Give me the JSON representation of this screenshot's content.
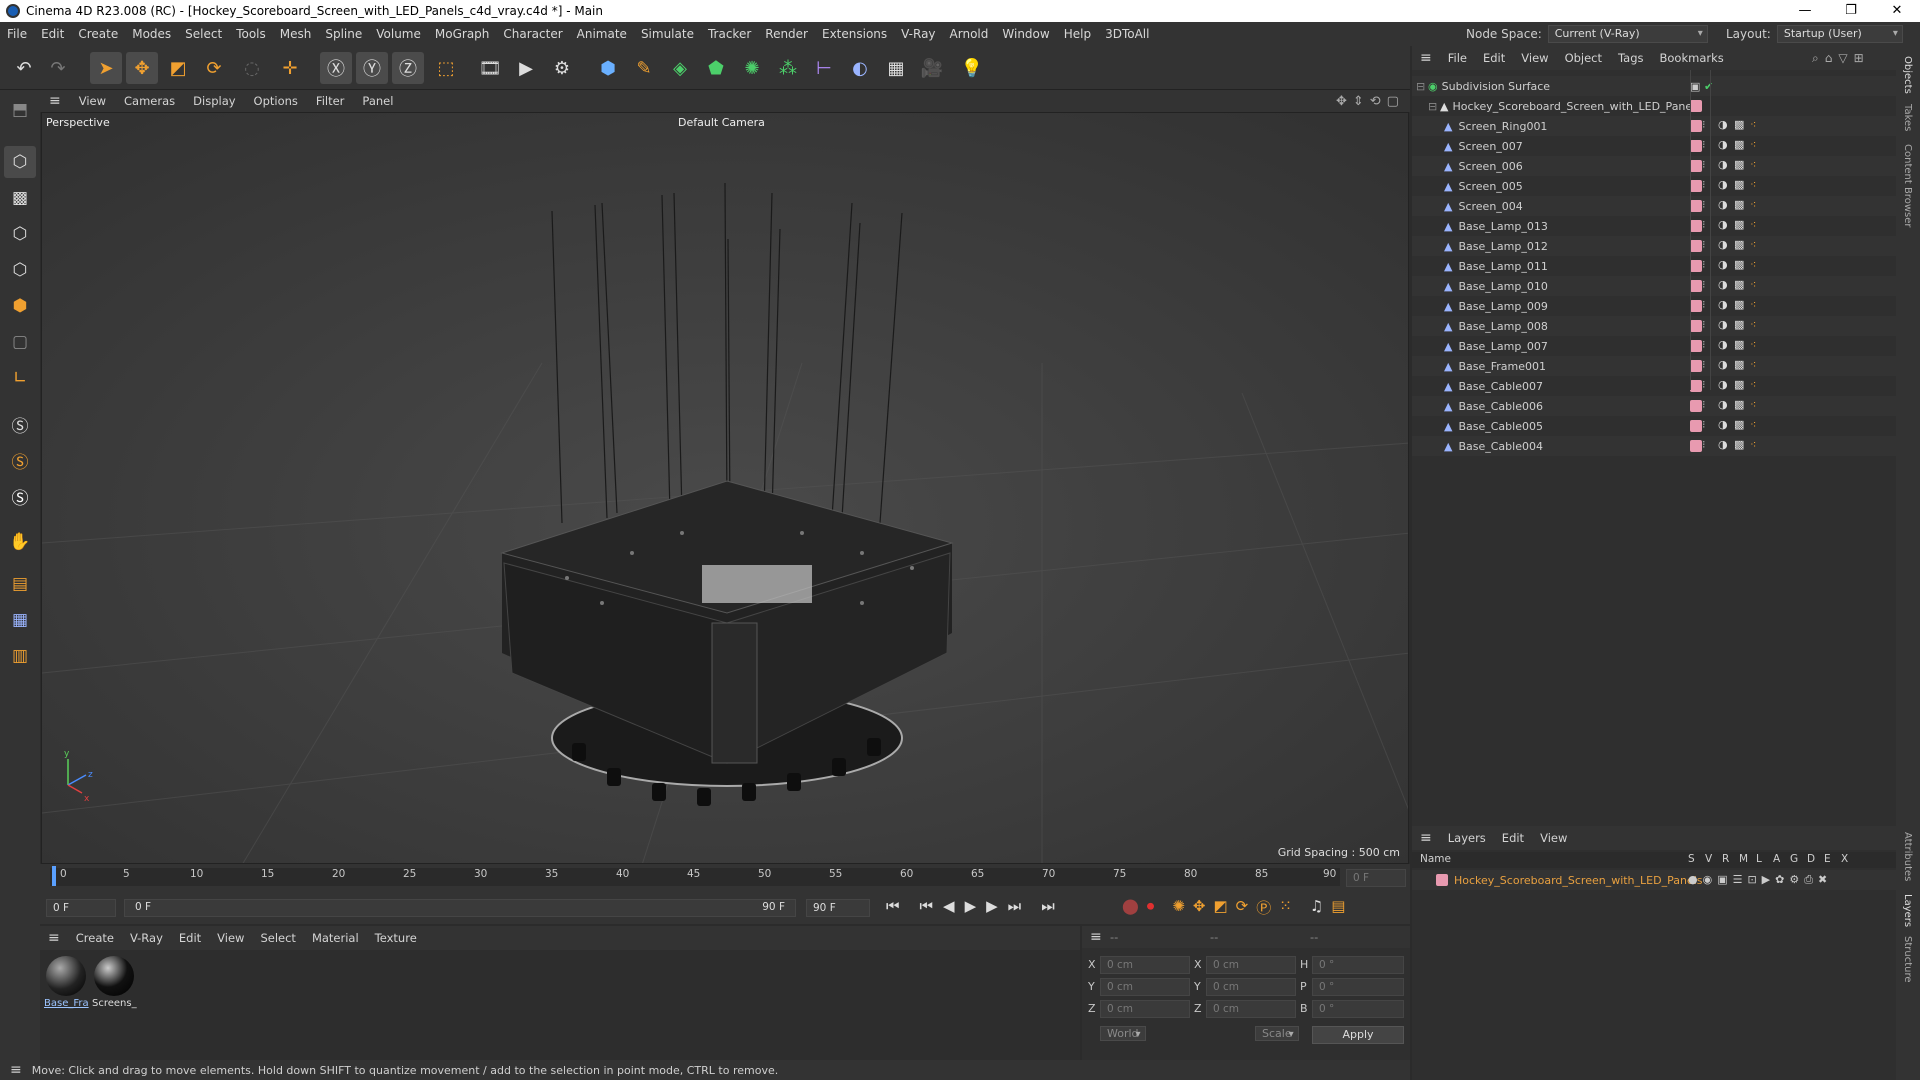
{
  "window": {
    "title": "Cinema 4D R23.008 (RC) - [Hockey_Scoreboard_Screen_with_LED_Panels_c4d_vray.c4d *] - Main"
  },
  "menu": [
    "File",
    "Edit",
    "Create",
    "Modes",
    "Select",
    "Tools",
    "Mesh",
    "Spline",
    "Volume",
    "MoGraph",
    "Character",
    "Animate",
    "Simulate",
    "Tracker",
    "Render",
    "Extensions",
    "V-Ray",
    "Arnold",
    "Window",
    "Help",
    "3DToAll"
  ],
  "node_space": {
    "label": "Node Space:",
    "value": "Current (V-Ray)"
  },
  "layout": {
    "label": "Layout:",
    "value": "Startup (User)"
  },
  "viewport": {
    "menu": [
      "View",
      "Cameras",
      "Display",
      "Options",
      "Filter",
      "Panel"
    ],
    "view_name": "Perspective",
    "camera": "Default Camera",
    "grid_spacing": "Grid Spacing : 500 cm"
  },
  "timeline": {
    "ticks": [
      "0",
      "5",
      "10",
      "15",
      "20",
      "25",
      "30",
      "35",
      "40",
      "45",
      "50",
      "55",
      "60",
      "65",
      "70",
      "75",
      "80",
      "85",
      "90"
    ],
    "current_frame": "0 F",
    "start": "0 F",
    "range_start": "0 F",
    "range_end": "90 F",
    "end": "90 F"
  },
  "material_menu": [
    "Create",
    "V-Ray",
    "Edit",
    "View",
    "Select",
    "Material",
    "Texture"
  ],
  "materials": [
    {
      "name": "Base_Fra"
    },
    {
      "name": "Screens_"
    }
  ],
  "coords": {
    "header": [
      "--",
      "--",
      "--"
    ],
    "rows": [
      {
        "a": "X",
        "av": "0 cm",
        "b": "X",
        "bv": "0 cm",
        "c": "H",
        "cv": "0 °"
      },
      {
        "a": "Y",
        "av": "0 cm",
        "b": "Y",
        "bv": "0 cm",
        "c": "P",
        "cv": "0 °"
      },
      {
        "a": "Z",
        "av": "0 cm",
        "b": "Z",
        "bv": "0 cm",
        "c": "B",
        "cv": "0 °"
      }
    ],
    "mode": "World",
    "scale": "Scale",
    "apply": "Apply"
  },
  "status": "Move: Click and drag to move elements. Hold down SHIFT to quantize movement / add to the selection in point mode, CTRL to remove.",
  "objects_menu": [
    "File",
    "Edit",
    "View",
    "Object",
    "Tags",
    "Bookmarks"
  ],
  "objects": {
    "root": "Subdivision Surface",
    "group": "Hockey_Scoreboard_Screen_with_LED_Panels",
    "children": [
      "Screen_Ring001",
      "Screen_007",
      "Screen_006",
      "Screen_005",
      "Screen_004",
      "Base_Lamp_013",
      "Base_Lamp_012",
      "Base_Lamp_011",
      "Base_Lamp_010",
      "Base_Lamp_009",
      "Base_Lamp_008",
      "Base_Lamp_007",
      "Base_Frame001",
      "Base_Cable007",
      "Base_Cable006",
      "Base_Cable005",
      "Base_Cable004"
    ]
  },
  "layers_menu": [
    "Layers",
    "Edit",
    "View"
  ],
  "layers": {
    "name_header": "Name",
    "columns": [
      "S",
      "V",
      "R",
      "M",
      "L",
      "A",
      "G",
      "D",
      "E",
      "X"
    ],
    "items": [
      {
        "name": "Hockey_Scoreboard_Screen_with_LED_Panels"
      }
    ]
  },
  "right_tabs": [
    "Objects",
    "Takes",
    "Content Browser",
    "Attributes",
    "Layers",
    "Structure"
  ],
  "colors": {
    "accent": "#f0a030",
    "layer": "#e89ab0",
    "selected_layer_text": "#e8a040"
  }
}
